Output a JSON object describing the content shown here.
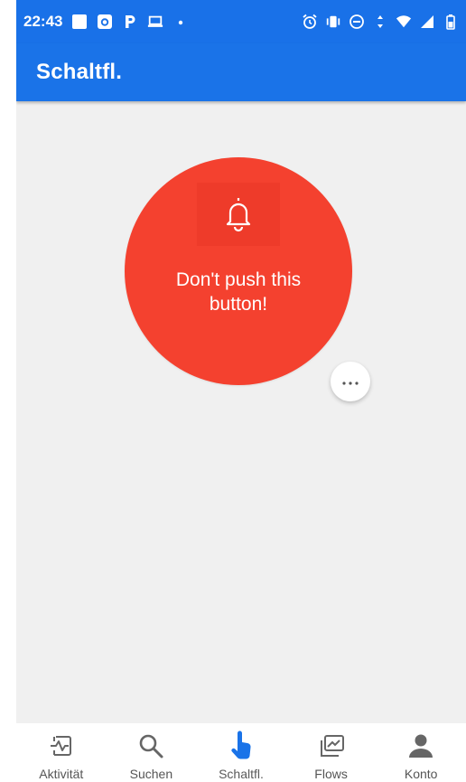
{
  "status_bar": {
    "time": "22:43",
    "left_icons": [
      "white-square-icon",
      "camera-icon",
      "p-icon",
      "laptop-icon",
      "dot-icon"
    ],
    "right_icons": [
      "alarm-icon",
      "vibrate-icon",
      "do-not-disturb-icon",
      "data-arrows-icon",
      "wifi-icon",
      "signal-icon",
      "battery-icon"
    ]
  },
  "app_bar": {
    "title": "Schaltfl."
  },
  "main": {
    "button_label": "Don't push this\nbutton!",
    "button_icon": "bell-icon",
    "more_icon": "more-horizontal-icon"
  },
  "bottom_nav": {
    "items": [
      {
        "label": "Aktivität",
        "icon": "activity-icon"
      },
      {
        "label": "Suchen",
        "icon": "search-icon"
      },
      {
        "label": "Schaltfl.",
        "icon": "touch-icon",
        "active": true
      },
      {
        "label": "Flows",
        "icon": "flows-icon"
      },
      {
        "label": "Konto",
        "icon": "account-icon"
      }
    ]
  },
  "colors": {
    "primary": "#1a73e8",
    "button_red": "#f4412f",
    "background": "#f0f0f0",
    "active_nav": "#1a73e8",
    "nav_icon": "#666666"
  }
}
